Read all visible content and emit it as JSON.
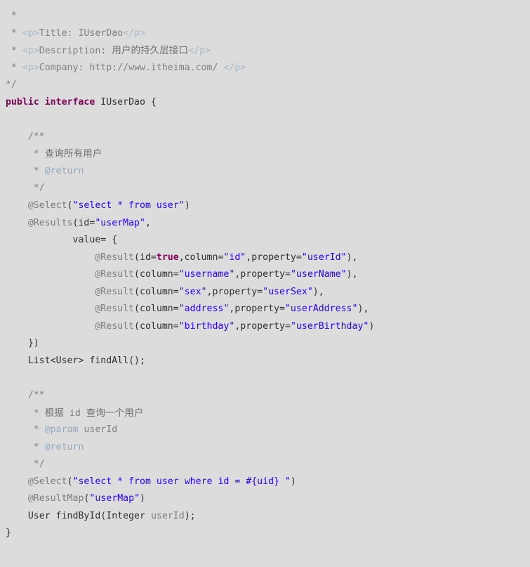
{
  "editor": {
    "background_color": "#dcdcdc",
    "language": "java",
    "file_kind": "java-interface-source"
  },
  "theme": {
    "comment_color": "#7f7f7f",
    "javadoc_tag_color": "#93a9bd",
    "html_tag_color": "#a9b8c6",
    "keyword_color": "#7f0055",
    "string_color": "#2a00ff",
    "annotation_color": "#7d7d7d",
    "plain_color": "#2f2f2f",
    "parameter_color": "#7d7d7d"
  },
  "code": {
    "lines": [
      {
        "n": 1,
        "indent": "  ",
        "tokens": [
          {
            "t": "*",
            "c": "tok-comment"
          }
        ]
      },
      {
        "n": 2,
        "indent": "  ",
        "tokens": [
          {
            "t": "* ",
            "c": "tok-comment"
          },
          {
            "t": "<p>",
            "c": "tok-html-tag"
          },
          {
            "t": "Title: IUserDao",
            "c": "tok-comment"
          },
          {
            "t": "</p>",
            "c": "tok-html-tag"
          }
        ]
      },
      {
        "n": 3,
        "indent": "  ",
        "tokens": [
          {
            "t": "* ",
            "c": "tok-comment"
          },
          {
            "t": "<p>",
            "c": "tok-html-tag"
          },
          {
            "t": "Description: ",
            "c": "tok-comment"
          },
          {
            "t": "用户的持久层接口",
            "c": "tok-cjk-comment"
          },
          {
            "t": "</p>",
            "c": "tok-html-tag"
          }
        ]
      },
      {
        "n": 4,
        "indent": "  ",
        "tokens": [
          {
            "t": "* ",
            "c": "tok-comment"
          },
          {
            "t": "<p>",
            "c": "tok-html-tag"
          },
          {
            "t": "Company: http://www.itheima.com/ ",
            "c": "tok-comment"
          },
          {
            "t": "</p>",
            "c": "tok-html-tag"
          }
        ]
      },
      {
        "n": 5,
        "indent": " ",
        "tokens": [
          {
            "t": "*/",
            "c": "tok-comment"
          }
        ]
      },
      {
        "n": 6,
        "indent": " ",
        "tokens": [
          {
            "t": "public interface",
            "c": "tok-keyword"
          },
          {
            "t": " IUserDao {",
            "c": "tok-plain"
          }
        ]
      },
      {
        "n": 7,
        "indent": "",
        "tokens": []
      },
      {
        "n": 8,
        "indent": "     ",
        "tokens": [
          {
            "t": "/**",
            "c": "tok-comment"
          }
        ]
      },
      {
        "n": 9,
        "indent": "     ",
        "tokens": [
          {
            "t": " * ",
            "c": "tok-comment"
          },
          {
            "t": "查询所有用户",
            "c": "tok-cjk-comment"
          }
        ]
      },
      {
        "n": 10,
        "indent": "     ",
        "tokens": [
          {
            "t": " * ",
            "c": "tok-comment"
          },
          {
            "t": "@return",
            "c": "tok-jdoc-tag"
          }
        ]
      },
      {
        "n": 11,
        "indent": "     ",
        "tokens": [
          {
            "t": " */",
            "c": "tok-comment"
          }
        ]
      },
      {
        "n": 12,
        "indent": "     ",
        "tokens": [
          {
            "t": "@Select",
            "c": "tok-anno"
          },
          {
            "t": "(",
            "c": "tok-plain"
          },
          {
            "t": "\"select * from user\"",
            "c": "tok-string"
          },
          {
            "t": ")",
            "c": "tok-plain"
          }
        ]
      },
      {
        "n": 13,
        "indent": "     ",
        "tokens": [
          {
            "t": "@Results",
            "c": "tok-anno"
          },
          {
            "t": "(id=",
            "c": "tok-plain"
          },
          {
            "t": "\"userMap\"",
            "c": "tok-string"
          },
          {
            "t": ",",
            "c": "tok-plain"
          }
        ]
      },
      {
        "n": 14,
        "indent": "             ",
        "tokens": [
          {
            "t": "value= {",
            "c": "tok-plain"
          }
        ]
      },
      {
        "n": 15,
        "indent": "                 ",
        "tokens": [
          {
            "t": "@Result",
            "c": "tok-anno"
          },
          {
            "t": "(id=",
            "c": "tok-plain"
          },
          {
            "t": "true",
            "c": "tok-keyword"
          },
          {
            "t": ",column=",
            "c": "tok-plain"
          },
          {
            "t": "\"id\"",
            "c": "tok-string"
          },
          {
            "t": ",property=",
            "c": "tok-plain"
          },
          {
            "t": "\"userId\"",
            "c": "tok-string"
          },
          {
            "t": "),",
            "c": "tok-plain"
          }
        ]
      },
      {
        "n": 16,
        "indent": "                 ",
        "tokens": [
          {
            "t": "@Result",
            "c": "tok-anno"
          },
          {
            "t": "(column=",
            "c": "tok-plain"
          },
          {
            "t": "\"username\"",
            "c": "tok-string"
          },
          {
            "t": ",property=",
            "c": "tok-plain"
          },
          {
            "t": "\"userName\"",
            "c": "tok-string"
          },
          {
            "t": "),",
            "c": "tok-plain"
          }
        ]
      },
      {
        "n": 17,
        "indent": "                 ",
        "tokens": [
          {
            "t": "@Result",
            "c": "tok-anno"
          },
          {
            "t": "(column=",
            "c": "tok-plain"
          },
          {
            "t": "\"sex\"",
            "c": "tok-string"
          },
          {
            "t": ",property=",
            "c": "tok-plain"
          },
          {
            "t": "\"userSex\"",
            "c": "tok-string"
          },
          {
            "t": "),",
            "c": "tok-plain"
          }
        ]
      },
      {
        "n": 18,
        "indent": "                 ",
        "tokens": [
          {
            "t": "@Result",
            "c": "tok-anno"
          },
          {
            "t": "(column=",
            "c": "tok-plain"
          },
          {
            "t": "\"address\"",
            "c": "tok-string"
          },
          {
            "t": ",property=",
            "c": "tok-plain"
          },
          {
            "t": "\"userAddress\"",
            "c": "tok-string"
          },
          {
            "t": "),",
            "c": "tok-plain"
          }
        ]
      },
      {
        "n": 19,
        "indent": "                 ",
        "tokens": [
          {
            "t": "@Result",
            "c": "tok-anno"
          },
          {
            "t": "(column=",
            "c": "tok-plain"
          },
          {
            "t": "\"birthday\"",
            "c": "tok-string"
          },
          {
            "t": ",property=",
            "c": "tok-plain"
          },
          {
            "t": "\"userBirthday\"",
            "c": "tok-string"
          },
          {
            "t": ")",
            "c": "tok-plain"
          }
        ]
      },
      {
        "n": 20,
        "indent": "     ",
        "tokens": [
          {
            "t": "})",
            "c": "tok-plain"
          }
        ]
      },
      {
        "n": 21,
        "indent": "     ",
        "tokens": [
          {
            "t": "List<User> findAll();",
            "c": "tok-plain"
          }
        ]
      },
      {
        "n": 22,
        "indent": "",
        "tokens": []
      },
      {
        "n": 23,
        "indent": "     ",
        "tokens": [
          {
            "t": "/**",
            "c": "tok-comment"
          }
        ]
      },
      {
        "n": 24,
        "indent": "     ",
        "tokens": [
          {
            "t": " * ",
            "c": "tok-comment"
          },
          {
            "t": "根据",
            "c": "tok-cjk-comment"
          },
          {
            "t": " id ",
            "c": "tok-comment"
          },
          {
            "t": "查询一个用户",
            "c": "tok-cjk-comment"
          }
        ]
      },
      {
        "n": 25,
        "indent": "     ",
        "tokens": [
          {
            "t": " * ",
            "c": "tok-comment"
          },
          {
            "t": "@param",
            "c": "tok-jdoc-tag"
          },
          {
            "t": " userId",
            "c": "tok-comment"
          }
        ]
      },
      {
        "n": 26,
        "indent": "     ",
        "tokens": [
          {
            "t": " * ",
            "c": "tok-comment"
          },
          {
            "t": "@return",
            "c": "tok-jdoc-tag"
          }
        ]
      },
      {
        "n": 27,
        "indent": "     ",
        "tokens": [
          {
            "t": " */",
            "c": "tok-comment"
          }
        ]
      },
      {
        "n": 28,
        "indent": "     ",
        "tokens": [
          {
            "t": "@Select",
            "c": "tok-anno"
          },
          {
            "t": "(",
            "c": "tok-plain"
          },
          {
            "t": "\"select * from user where id = #{uid} \"",
            "c": "tok-string"
          },
          {
            "t": ")",
            "c": "tok-plain"
          }
        ]
      },
      {
        "n": 29,
        "indent": "     ",
        "tokens": [
          {
            "t": "@ResultMap",
            "c": "tok-anno"
          },
          {
            "t": "(",
            "c": "tok-plain"
          },
          {
            "t": "\"userMap\"",
            "c": "tok-string"
          },
          {
            "t": ")",
            "c": "tok-plain"
          }
        ]
      },
      {
        "n": 30,
        "indent": "     ",
        "tokens": [
          {
            "t": "User findById(Integer ",
            "c": "tok-plain"
          },
          {
            "t": "userId",
            "c": "tok-param"
          },
          {
            "t": ");",
            "c": "tok-plain"
          }
        ]
      },
      {
        "n": 31,
        "indent": " ",
        "tokens": [
          {
            "t": "}",
            "c": "tok-plain"
          }
        ]
      }
    ]
  }
}
